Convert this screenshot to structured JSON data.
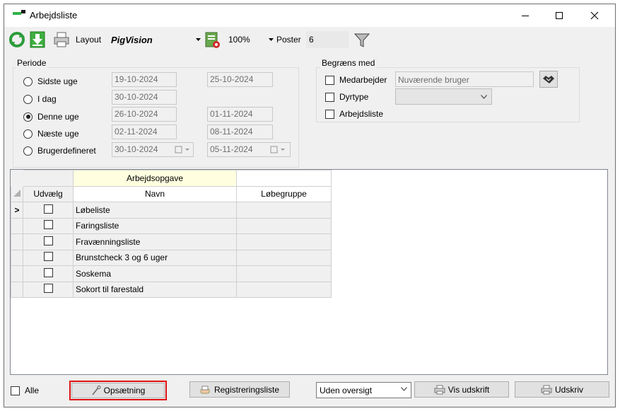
{
  "window": {
    "title": "Arbejdsliste",
    "controls": {
      "minimize": "—",
      "maximize": "☐",
      "close": "✕"
    }
  },
  "toolbar": {
    "layout_label": "Layout",
    "layout_value": "PigVision",
    "zoom_value": "100%",
    "poster_label": "Poster",
    "poster_value": "6"
  },
  "periode": {
    "title": "Periode",
    "options": [
      {
        "label": "Sidste uge",
        "from": "19-10-2024",
        "to": "25-10-2024",
        "checked": false
      },
      {
        "label": "I dag",
        "from": "30-10-2024",
        "to": "",
        "checked": false
      },
      {
        "label": "Denne uge",
        "from": "26-10-2024",
        "to": "01-11-2024",
        "checked": true
      },
      {
        "label": "Næste uge",
        "from": "02-11-2024",
        "to": "08-11-2024",
        "checked": false
      },
      {
        "label": "Brugerdefineret",
        "from": "30-10-2024",
        "to": "05-11-2024",
        "checked": false
      }
    ]
  },
  "begraens": {
    "title": "Begræns med",
    "medarbejder_label": "Medarbejder",
    "medarbejder_placeholder": "Nuværende bruger",
    "dyrtype_label": "Dyrtype",
    "arbejdsliste_label": "Arbejdsliste"
  },
  "grid": {
    "group_header": "Arbejdsopgave",
    "columns": {
      "udvaelg": "Udvælg",
      "navn": "Navn",
      "lobegruppe": "Løbegruppe"
    },
    "current_marker": ">",
    "rows": [
      {
        "navn": "Løbeliste",
        "lobegruppe": ""
      },
      {
        "navn": "Faringsliste",
        "lobegruppe": ""
      },
      {
        "navn": "Fravænningsliste",
        "lobegruppe": ""
      },
      {
        "navn": "Brunstcheck 3 og 6 uger",
        "lobegruppe": ""
      },
      {
        "navn": "Soskema",
        "lobegruppe": ""
      },
      {
        "navn": "Sokort til farestald",
        "lobegruppe": ""
      }
    ]
  },
  "footer": {
    "alle_label": "Alle",
    "opsaetning_label": "Opsætning",
    "registreringsliste_label": "Registreringsliste",
    "oversigt_value": "Uden oversigt",
    "vis_udskrift_label": "Vis udskrift",
    "udskriv_label": "Udskriv"
  },
  "colors": {
    "highlight_border": "#e01010",
    "group_header_bg": "#ffffe0"
  }
}
